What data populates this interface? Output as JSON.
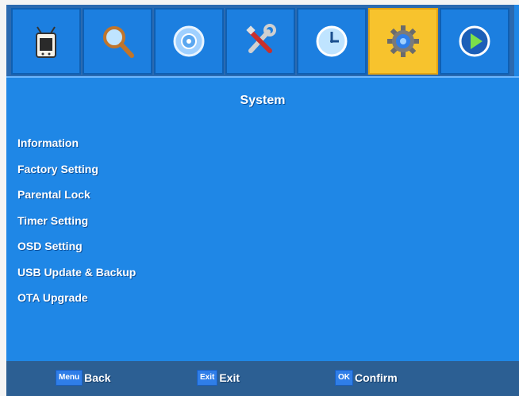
{
  "tabs": [
    {
      "icon": "tv-icon",
      "active": false
    },
    {
      "icon": "search-icon",
      "active": false
    },
    {
      "icon": "disc-icon",
      "active": false
    },
    {
      "icon": "tools-icon",
      "active": false
    },
    {
      "icon": "clock-icon",
      "active": false
    },
    {
      "icon": "gear-icon",
      "active": true
    },
    {
      "icon": "play-icon",
      "active": false
    }
  ],
  "title": "System",
  "menu": [
    "Information",
    "Factory Setting",
    "Parental Lock",
    "Timer Setting",
    "OSD Setting",
    "USB Update & Backup",
    "OTA Upgrade"
  ],
  "footer": {
    "back_key": "Menu",
    "back_label": "Back",
    "exit_key": "Exit",
    "exit_label": "Exit",
    "confirm_key": "OK",
    "confirm_label": "Confirm"
  },
  "colors": {
    "background": "#1f87e6",
    "active_tab": "#f7c32d",
    "footer": "#2c5f93"
  }
}
